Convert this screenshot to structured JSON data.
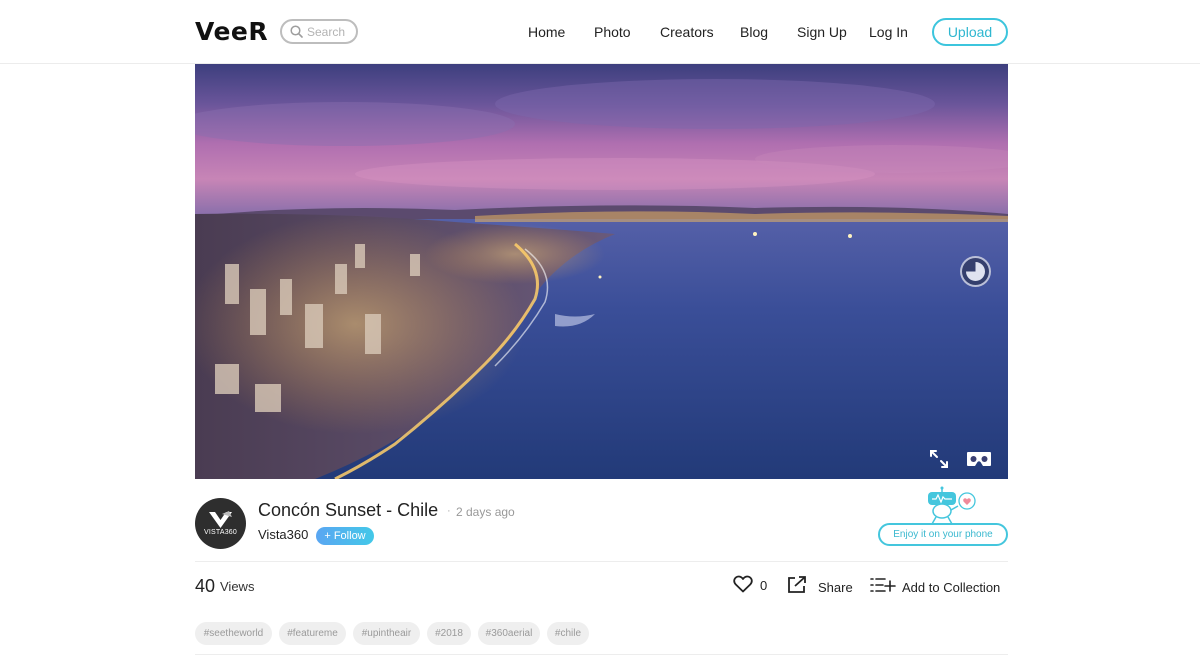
{
  "header": {
    "logo": "VeeR",
    "search_placeholder": "Search",
    "nav": [
      "Home",
      "Photo",
      "Creators",
      "Blog",
      "Sign Up",
      "Log In"
    ],
    "upload_label": "Upload"
  },
  "photo": {
    "title": "Concón Sunset - Chile",
    "separator": "·",
    "posted": "2 days ago",
    "author": "Vista360",
    "follow_label": "+ Follow",
    "avatar_brand": "VISTA360",
    "views_count": "40",
    "views_label": "Views",
    "likes": "0",
    "share_label": "Share",
    "collection_label": "Add to Collection",
    "phone_label": "Enjoy it on your phone",
    "tags": [
      "#seetheworld",
      "#featureme",
      "#upintheair",
      "#2018",
      "#360aerial",
      "#chile"
    ]
  },
  "colors": {
    "accent": "#3cc5dd",
    "follow_gradient_start": "#5aa6f2",
    "follow_gradient_end": "#43c8e8",
    "tag_bg": "#efefef"
  },
  "icons": [
    "search-icon",
    "compass-icon",
    "fullscreen-icon",
    "vr-headset-icon",
    "heart-icon",
    "share-icon",
    "add-to-collection-icon"
  ]
}
